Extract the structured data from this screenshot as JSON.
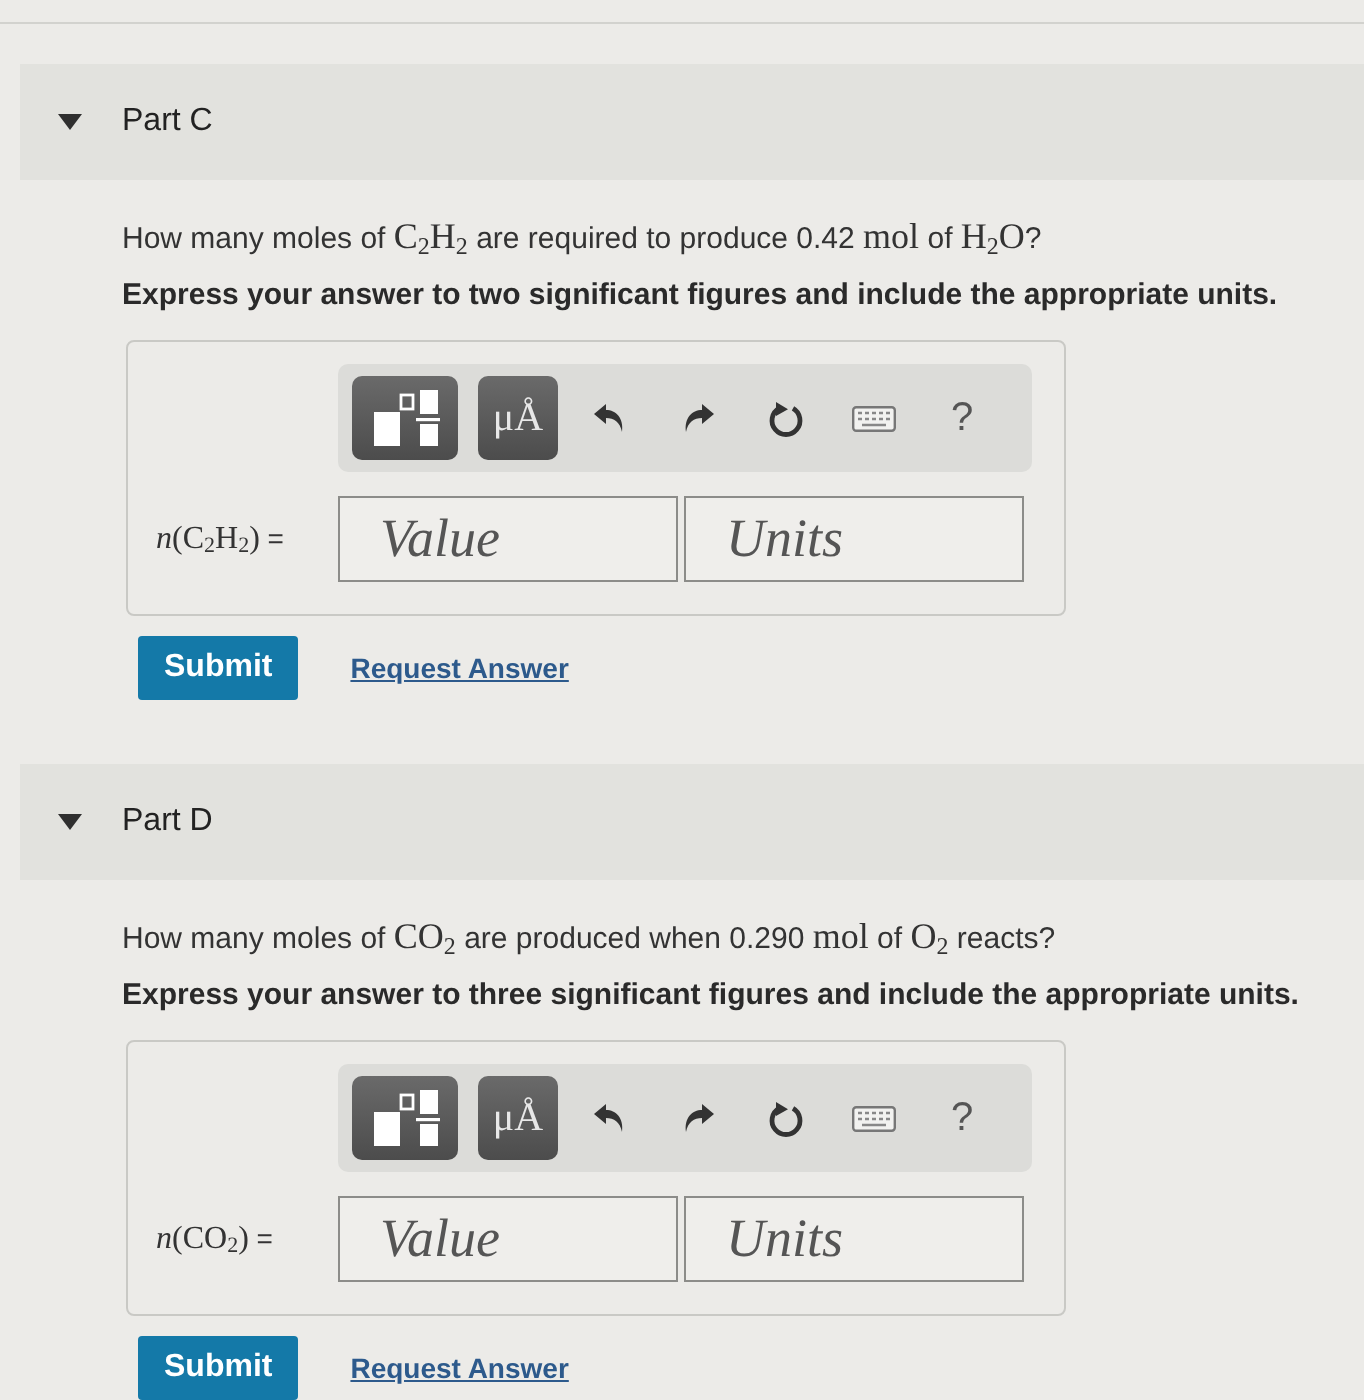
{
  "parts": [
    {
      "title": "Part C",
      "expanded": true,
      "question": [
        {
          "kind": "plain",
          "text": "How many moles of "
        },
        {
          "kind": "math",
          "text": "C$_{2}$H$_{2}$"
        },
        {
          "kind": "plain",
          "text": " are required to produce 0.42 "
        },
        {
          "kind": "math",
          "text": "mol"
        },
        {
          "kind": "plain",
          "text": " of "
        },
        {
          "kind": "math",
          "text": "H$_{2}$O"
        },
        {
          "kind": "plain",
          "text": "?"
        }
      ],
      "instruction": "Express your answer to two significant figures and include the appropriate units.",
      "toolbar": {
        "symbols": "μÅ",
        "help": "?"
      },
      "answer_label": [
        {
          "kind": "math",
          "text": "*n*(C$_{2}$H$_{2}$)"
        },
        {
          "kind": "plain",
          "text": " ="
        }
      ],
      "value": {
        "placeholder": "Value"
      },
      "units": {
        "placeholder": "Units"
      },
      "submit": "Submit",
      "request_answer": "Request Answer"
    },
    {
      "title": "Part D",
      "expanded": true,
      "question": [
        {
          "kind": "plain",
          "text": "How many moles of "
        },
        {
          "kind": "math",
          "text": "CO$_{2}$"
        },
        {
          "kind": "plain",
          "text": " are produced when 0.290 "
        },
        {
          "kind": "math",
          "text": "mol"
        },
        {
          "kind": "plain",
          "text": " of "
        },
        {
          "kind": "math",
          "text": "O$_{2}$"
        },
        {
          "kind": "plain",
          "text": " reacts?"
        }
      ],
      "instruction": "Express your answer to three significant figures and include the appropriate units.",
      "toolbar": {
        "symbols": "μÅ",
        "help": "?"
      },
      "answer_label": [
        {
          "kind": "math",
          "text": "*n*(CO$_{2}$)"
        },
        {
          "kind": "plain",
          "text": " ="
        }
      ],
      "value": {
        "placeholder": "Value"
      },
      "units": {
        "placeholder": "Units"
      },
      "submit": "Submit",
      "request_answer": "Request Answer"
    }
  ]
}
